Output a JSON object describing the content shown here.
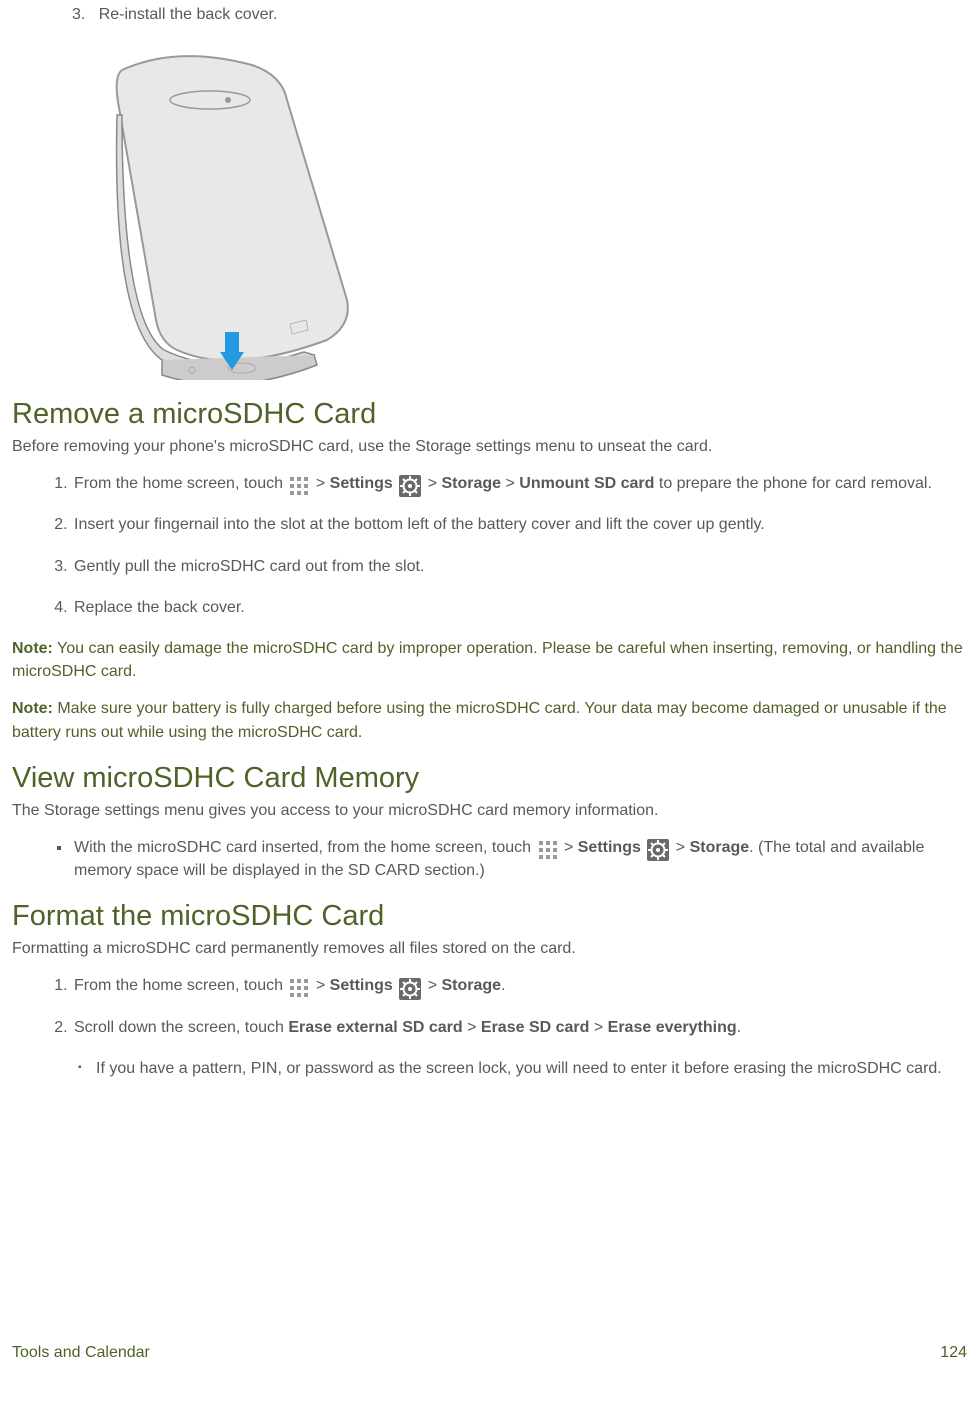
{
  "top": {
    "step3_num": "3.",
    "step3_text": "Re-install the back cover."
  },
  "remove": {
    "heading": "Remove a microSDHC Card",
    "intro": "Before removing your phone's microSDHC card, use the Storage settings menu to unseat the card.",
    "s1_a": "From the home screen, touch ",
    "s1_b": " > ",
    "s1_settings": "Settings",
    "s1_c": " > ",
    "s1_storage": "Storage",
    "s1_d": " > ",
    "s1_unmount": "Unmount SD card",
    "s1_e": " to prepare the phone for card removal.",
    "s2": "Insert your fingernail into the slot at the bottom left of the battery cover and lift the cover up gently.",
    "s3": "Gently pull the microSDHC card out from the slot.",
    "s4": "Replace the back cover.",
    "note1_label": "Note:",
    "note1_text": " You can easily damage the microSDHC card by improper operation. Please be careful when inserting, removing, or handling the microSDHC card.",
    "note2_label": "Note:",
    "note2_text": " Make sure your battery is fully charged before using the microSDHC card. Your data may become damaged or unusable if the battery runs out while using the microSDHC card."
  },
  "view": {
    "heading": "View microSDHC Card Memory",
    "intro": "The Storage settings menu gives you access to your microSDHC card memory information.",
    "b_a": "With the microSDHC card inserted, from the home screen, touch ",
    "b_b": " > ",
    "b_settings": "Settings",
    "b_c": " > ",
    "b_storage": "Storage",
    "b_d": ". (The total and available memory space will be displayed in the SD CARD section.)"
  },
  "format": {
    "heading": "Format the microSDHC Card",
    "intro": "Formatting a microSDHC card permanently removes all files stored on the card.",
    "s1_a": "From the home screen, touch ",
    "s1_b": " > ",
    "s1_settings": "Settings",
    "s1_c": " > ",
    "s1_storage": "Storage",
    "s1_d": ".",
    "s2_a": "Scroll down the screen, touch ",
    "s2_erase_ext": "Erase external SD card",
    "s2_b": " > ",
    "s2_erase_sd": "Erase SD card",
    "s2_c": " > ",
    "s2_erase_all": "Erase everything",
    "s2_d": ".",
    "sub": "If you have a pattern, PIN, or password as the screen lock, you will need to enter it before erasing the microSDHC card."
  },
  "footer": {
    "left": "Tools and Calendar",
    "right": "124"
  }
}
